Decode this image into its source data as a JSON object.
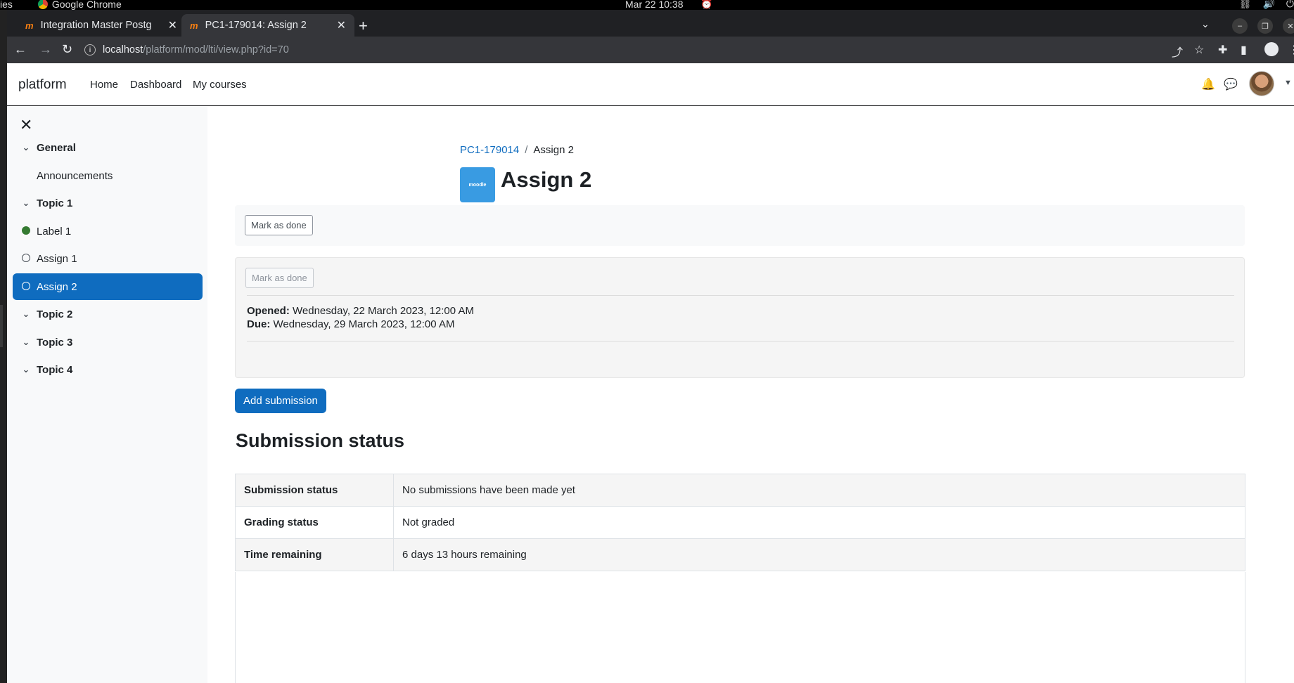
{
  "os": {
    "left_fragment": "ies",
    "app_name": "Google Chrome",
    "clock": "Mar 22  10:38"
  },
  "browser": {
    "tabs": [
      {
        "favicon": "m",
        "title": "Integration Master Postg",
        "active": false
      },
      {
        "favicon": "m",
        "title": "PC1-179014: Assign 2",
        "active": true
      }
    ],
    "url_host": "localhost",
    "url_path": "/platform/mod/lti/view.php?id=70"
  },
  "navbar": {
    "brand": "platform",
    "links": [
      "Home",
      "Dashboard",
      "My courses"
    ]
  },
  "drawer": {
    "items": [
      {
        "label": "General",
        "type": "section"
      },
      {
        "label": "Announcements",
        "type": "activity",
        "status": "none"
      },
      {
        "label": "Topic 1",
        "type": "section"
      },
      {
        "label": "Label 1",
        "type": "activity",
        "status": "done"
      },
      {
        "label": "Assign 1",
        "type": "activity",
        "status": "open"
      },
      {
        "label": "Assign 2",
        "type": "activity",
        "status": "open",
        "active": true
      },
      {
        "label": "Topic 2",
        "type": "section"
      },
      {
        "label": "Topic 3",
        "type": "section"
      },
      {
        "label": "Topic 4",
        "type": "section"
      }
    ]
  },
  "main": {
    "breadcrumb": {
      "course": "PC1-179014",
      "separator": "/",
      "current": "Assign 2"
    },
    "module_icon_text": "moodle",
    "title": "Assign 2",
    "mark_done_label": "Mark as done",
    "mark_done_disabled_label": "Mark as done",
    "opened_label": "Opened:",
    "opened_value": "Wednesday, 22 March 2023, 12:00 AM",
    "due_label": "Due:",
    "due_value": "Wednesday, 29 March 2023, 12:00 AM",
    "add_submission_label": "Add submission",
    "section_title": "Submission status",
    "status_rows": [
      {
        "label": "Submission status",
        "value": "No submissions have been made yet"
      },
      {
        "label": "Grading status",
        "value": "Not graded"
      },
      {
        "label": "Time remaining",
        "value": "6 days 13 hours remaining"
      }
    ]
  },
  "colors": {
    "primary": "#0f6cbf",
    "done": "#357a32",
    "brand_orange": "#f98012"
  }
}
